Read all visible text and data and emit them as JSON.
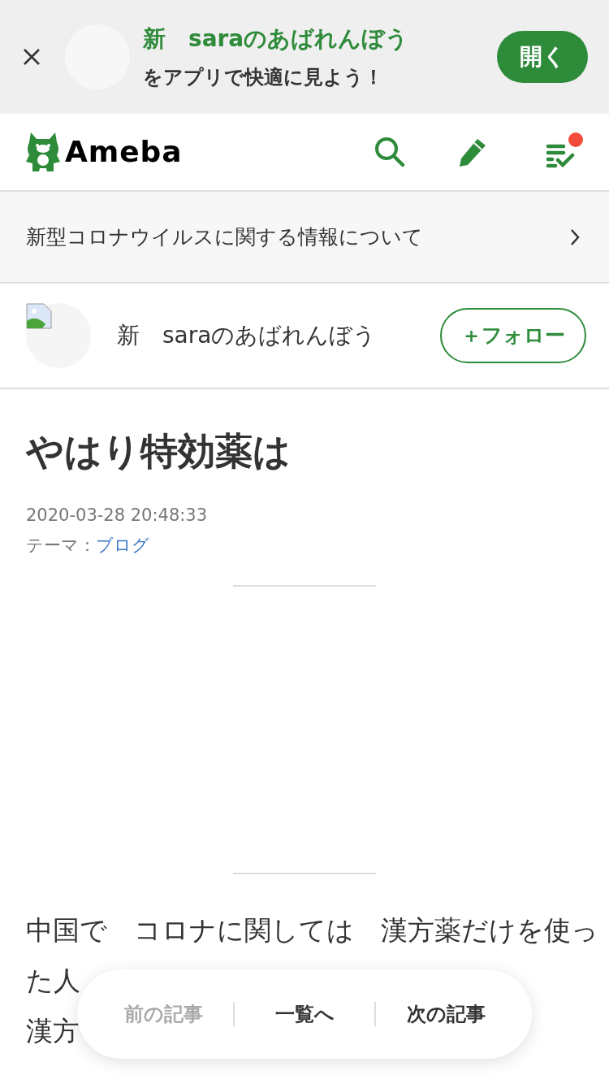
{
  "app_banner": {
    "title": "新　saraのあばれんぼう",
    "subtitle": "をアプリで快適に見よう！",
    "open_button": "開く"
  },
  "header": {
    "logo": "Ameba",
    "notification_dot": true
  },
  "notice": {
    "text": "新型コロナウイルスに関する情報について"
  },
  "author": {
    "name": "新　saraのあばれんぼう",
    "follow_button": "＋フォロー"
  },
  "article": {
    "title": "やはり特効薬は",
    "date": "2020-03-28 20:48:33",
    "theme_label": "テーマ：",
    "theme_link": "ブログ",
    "lines": [
      {
        "left": "中国で　コロナに関しては　漢方薬だけを使っ"
      },
      {
        "left": "た人"
      },
      {
        "left": "漢方"
      }
    ]
  },
  "pager": [
    {
      "label": "前の記事",
      "disabled": true
    },
    {
      "label": "一覧へ",
      "disabled": false
    },
    {
      "label": "次の記事",
      "disabled": false
    }
  ]
}
